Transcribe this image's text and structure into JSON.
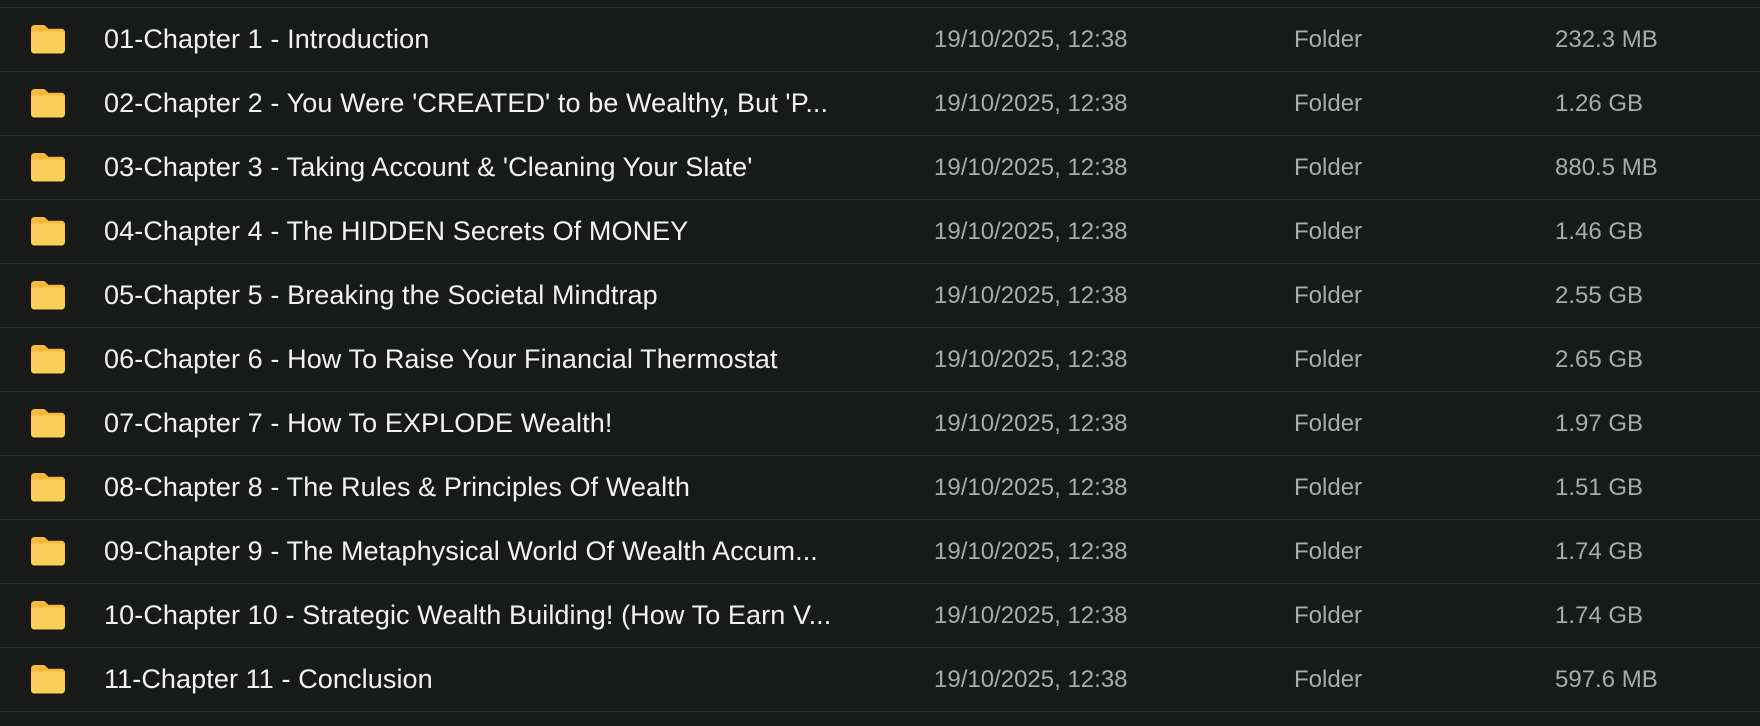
{
  "colors": {
    "background": "#181919",
    "row_divider": "#2d2e2e",
    "name_text": "#f2f2f2",
    "meta_text": "#a9aaaa",
    "folder_icon": "#f6b73c"
  },
  "icon": "folder-icon",
  "rows": [
    {
      "name": "01-Chapter 1 - Introduction",
      "modified": "19/10/2025, 12:38",
      "kind": "Folder",
      "size": "232.3 MB"
    },
    {
      "name": "02-Chapter 2 - You Were 'CREATED' to be Wealthy, But 'P...",
      "modified": "19/10/2025, 12:38",
      "kind": "Folder",
      "size": "1.26 GB"
    },
    {
      "name": "03-Chapter 3 - Taking Account & 'Cleaning Your Slate'",
      "modified": "19/10/2025, 12:38",
      "kind": "Folder",
      "size": "880.5 MB"
    },
    {
      "name": "04-Chapter 4 - The HIDDEN Secrets Of MONEY",
      "modified": "19/10/2025, 12:38",
      "kind": "Folder",
      "size": "1.46 GB"
    },
    {
      "name": "05-Chapter 5 - Breaking the Societal Mindtrap",
      "modified": "19/10/2025, 12:38",
      "kind": "Folder",
      "size": "2.55 GB"
    },
    {
      "name": "06-Chapter 6 - How To Raise Your Financial Thermostat",
      "modified": "19/10/2025, 12:38",
      "kind": "Folder",
      "size": "2.65 GB"
    },
    {
      "name": "07-Chapter 7 - How To EXPLODE Wealth!",
      "modified": "19/10/2025, 12:38",
      "kind": "Folder",
      "size": "1.97 GB"
    },
    {
      "name": "08-Chapter 8 - The Rules & Principles Of Wealth",
      "modified": "19/10/2025, 12:38",
      "kind": "Folder",
      "size": "1.51 GB"
    },
    {
      "name": "09-Chapter 9 - The Metaphysical World Of Wealth Accum...",
      "modified": "19/10/2025, 12:38",
      "kind": "Folder",
      "size": "1.74 GB"
    },
    {
      "name": "10-Chapter 10 - Strategic Wealth Building! (How To Earn V...",
      "modified": "19/10/2025, 12:38",
      "kind": "Folder",
      "size": "1.74 GB"
    },
    {
      "name": "11-Chapter 11 - Conclusion",
      "modified": "19/10/2025, 12:38",
      "kind": "Folder",
      "size": "597.6 MB"
    }
  ]
}
